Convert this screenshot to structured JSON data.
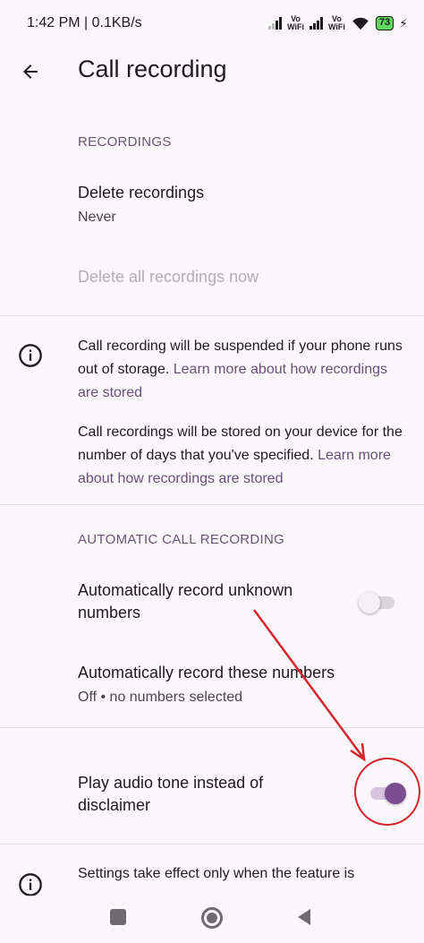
{
  "status_bar": {
    "time_speed": "1:42 PM | 0.1KB/s",
    "vowifi_1": "Vo\nWiFi",
    "vowifi_2": "Vo\nWiFi",
    "battery": "73"
  },
  "app_bar": {
    "title": "Call recording"
  },
  "recordings": {
    "header": "RECORDINGS",
    "delete_title": "Delete recordings",
    "delete_value": "Never",
    "delete_all": "Delete all recordings now"
  },
  "info_1": {
    "text1": "Call recording will be suspended if your phone runs out of storage.",
    "link1": "Learn more about how recordings are stored",
    "text2": "Call recordings will be stored on your device for the number of days that you've specified.",
    "link2": "Learn more about how recordings are stored"
  },
  "automatic": {
    "header": "AUTOMATIC CALL RECORDING",
    "unknown_title": "Automatically record unknown numbers",
    "unknown_on": false,
    "these_title": "Automatically record these numbers",
    "these_sub": "Off • no numbers selected"
  },
  "tone": {
    "title": "Play audio tone instead of disclaimer",
    "on": true
  },
  "info_2": {
    "text": "Settings take effect only when the feature is"
  },
  "colors": {
    "accent": "#7b4d8e",
    "link": "#6b4f78",
    "annotation": "#d8232f"
  }
}
